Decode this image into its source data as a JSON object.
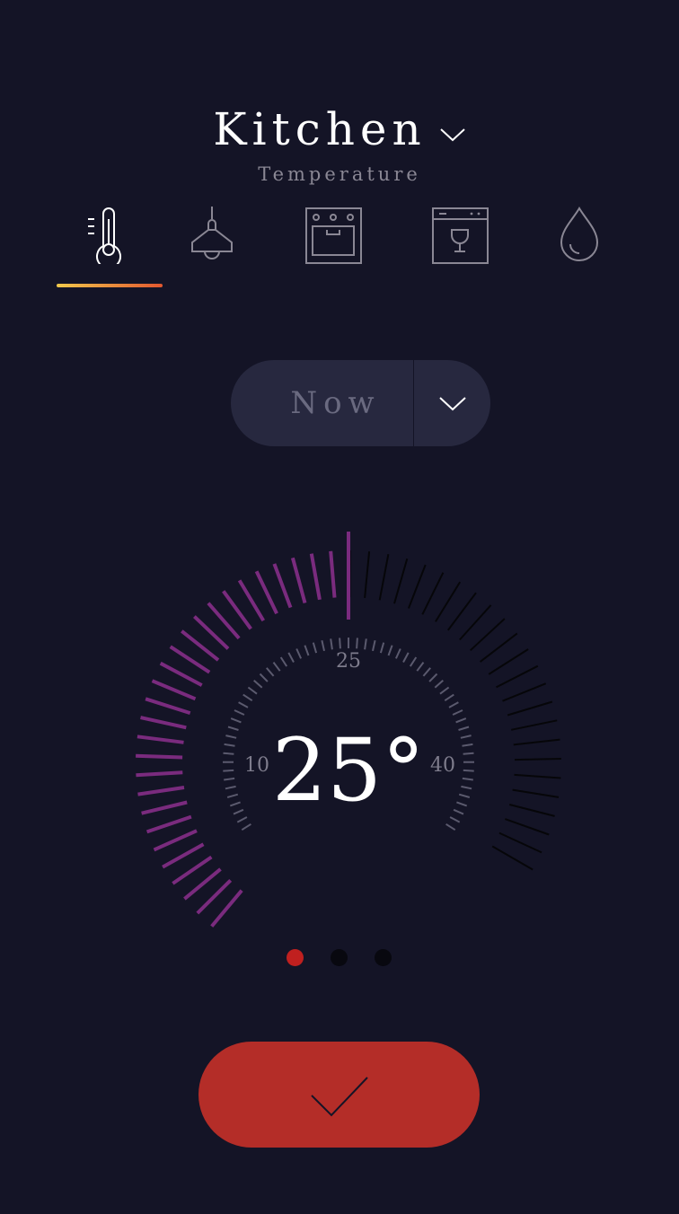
{
  "header": {
    "room": "Kitchen",
    "subtitle": "Temperature"
  },
  "tabs": [
    {
      "name": "thermometer-icon",
      "label": "Temperature",
      "active": true
    },
    {
      "name": "pendant-lamp-icon",
      "label": "Lights",
      "active": false
    },
    {
      "name": "oven-icon",
      "label": "Oven",
      "active": false
    },
    {
      "name": "dishwasher-icon",
      "label": "Dishwasher",
      "active": false
    },
    {
      "name": "water-drop-icon",
      "label": "Water",
      "active": false
    }
  ],
  "time_select": {
    "label": "Now"
  },
  "thermostat": {
    "value": 25,
    "display": "25°",
    "unit": "°",
    "min_label": "10",
    "mid_label": "25",
    "max_label": "40",
    "min": 10,
    "max": 40,
    "fill_fraction": 0.5
  },
  "pagination": {
    "count": 3,
    "active_index": 0
  },
  "colors": {
    "background": "#141426",
    "accent_red": "#b42d28",
    "dot_active": "#c0201f",
    "dot_inactive": "#08080f",
    "dial_active": "#7a2b7e",
    "dial_inactive": "#060609",
    "underline_start": "#f2c94c",
    "underline_end": "#e2572f",
    "pill": "#27283f"
  },
  "icons": {
    "room_chevron": "chevron-down-icon",
    "dropdown": "chevron-down-icon",
    "confirm": "checkmark-icon"
  }
}
